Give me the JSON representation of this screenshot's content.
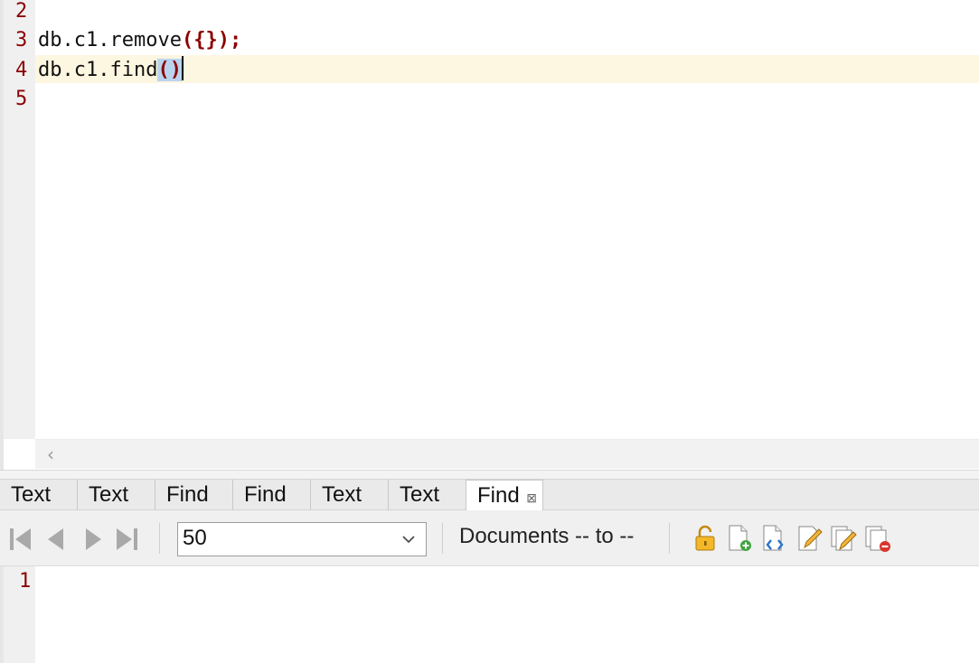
{
  "editor": {
    "lines": [
      {
        "number": "2",
        "code": ""
      },
      {
        "number": "3",
        "code": "db.c1.remove({});"
      },
      {
        "number": "4",
        "code": "db.c1.find()"
      },
      {
        "number": "5",
        "code": ""
      }
    ],
    "line3_prefix": "db.c1.remove",
    "line3_parens": "({})",
    "line3_suffix": ";",
    "line4_prefix": "db.c1.find",
    "line4_selected_parens": "()"
  },
  "tabs": [
    {
      "label": "Text"
    },
    {
      "label": "Text"
    },
    {
      "label": "Find"
    },
    {
      "label": "Find"
    },
    {
      "label": "Text"
    },
    {
      "label": "Text"
    },
    {
      "label": "Find",
      "active": true,
      "close": "⊠"
    }
  ],
  "toolbar": {
    "page_size": "50",
    "range_label": "Documents -- to --",
    "nav_icons": [
      "first-page-icon",
      "previous-page-icon",
      "next-page-icon",
      "last-page-icon"
    ],
    "tool_icons": [
      "lock-icon",
      "add-document-icon",
      "view-json-icon",
      "edit-document-icon",
      "edit-documents-icon",
      "delete-documents-icon"
    ]
  },
  "results": {
    "line_number": "1"
  },
  "colors": {
    "line_number": "#8b0000",
    "current_line_bg": "#fdf6e0",
    "selection_bg": "#b8d4ef"
  }
}
